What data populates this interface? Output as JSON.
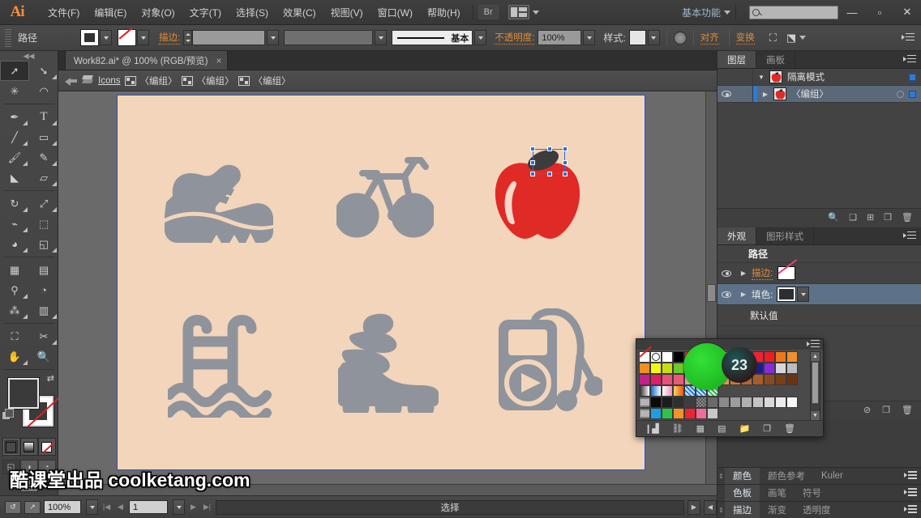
{
  "app": {
    "logo": "Ai"
  },
  "menubar": {
    "items": [
      "文件(F)",
      "编辑(E)",
      "对象(O)",
      "文字(T)",
      "选择(S)",
      "效果(C)",
      "视图(V)",
      "窗口(W)",
      "帮助(H)"
    ],
    "bridge": "Br",
    "workspace": "基本功能",
    "search_placeholder": ""
  },
  "controlbar": {
    "object_label": "路径",
    "stroke_label": "描边:",
    "stroke_weight": "",
    "stroke_profile": "",
    "brush_label": "基本",
    "opacity_label": "不透明度:",
    "opacity_value": "100%",
    "style_label": "样式:",
    "align_label": "对齐",
    "transform_label": "变换"
  },
  "toolbar": {
    "tools": [
      {
        "name": "selection-tool",
        "glyph": "➚",
        "selected": true
      },
      {
        "name": "direct-selection-tool",
        "glyph": "➘",
        "selected": false
      },
      {
        "name": "magic-wand-tool",
        "glyph": "✳",
        "selected": false
      },
      {
        "name": "lasso-tool",
        "glyph": "◠",
        "selected": false
      },
      {
        "name": "pen-tool",
        "glyph": "✒",
        "selected": false
      },
      {
        "name": "type-tool",
        "glyph": "T",
        "selected": false
      },
      {
        "name": "line-segment-tool",
        "glyph": "╱",
        "selected": false
      },
      {
        "name": "rectangle-tool",
        "glyph": "▭",
        "selected": false
      },
      {
        "name": "paintbrush-tool",
        "glyph": "🖌",
        "selected": false
      },
      {
        "name": "pencil-tool",
        "glyph": "✎",
        "selected": false
      },
      {
        "name": "blob-brush-tool",
        "glyph": "◣",
        "selected": false
      },
      {
        "name": "eraser-tool",
        "glyph": "▱",
        "selected": false
      },
      {
        "name": "rotate-tool",
        "glyph": "↻",
        "selected": false
      },
      {
        "name": "scale-tool",
        "glyph": "⤢",
        "selected": false
      },
      {
        "name": "width-tool",
        "glyph": "⌁",
        "selected": false
      },
      {
        "name": "free-transform-tool",
        "glyph": "⬚",
        "selected": false
      },
      {
        "name": "shape-builder-tool",
        "glyph": "◕",
        "selected": false
      },
      {
        "name": "perspective-grid-tool",
        "glyph": "◲",
        "selected": false
      },
      {
        "name": "mesh-tool",
        "glyph": "▦",
        "selected": false
      },
      {
        "name": "gradient-tool",
        "glyph": "▤",
        "selected": false
      },
      {
        "name": "eyedropper-tool",
        "glyph": "⚲",
        "selected": false
      },
      {
        "name": "blend-tool",
        "glyph": "◔",
        "selected": false
      },
      {
        "name": "symbol-sprayer-tool",
        "glyph": "⁂",
        "selected": false
      },
      {
        "name": "column-graph-tool",
        "glyph": "▥",
        "selected": false
      },
      {
        "name": "artboard-tool",
        "glyph": "⛶",
        "selected": false
      },
      {
        "name": "slice-tool",
        "glyph": "✂",
        "selected": false
      },
      {
        "name": "hand-tool",
        "glyph": "✋",
        "selected": false
      },
      {
        "name": "zoom-tool",
        "glyph": "🔍",
        "selected": false
      }
    ]
  },
  "document": {
    "tab_title": "Work82.ai* @ 100% (RGB/预览)",
    "close_glyph": "×"
  },
  "breadcrumb": {
    "root": "Icons",
    "groups": [
      "〈编组〉",
      "〈编组〉",
      "〈编组〉"
    ]
  },
  "canvas": {
    "artboard_bg": "#f2d5ba",
    "icon_color": "#8f939c",
    "apple_color": "#e02a26",
    "leaf_color": "#3c3c3c",
    "icons": [
      {
        "name": "sneaker-icon"
      },
      {
        "name": "bicycle-icon"
      },
      {
        "name": "apple-icon"
      },
      {
        "name": "pool-ladder-icon"
      },
      {
        "name": "roller-skate-icon"
      },
      {
        "name": "music-player-icon"
      }
    ]
  },
  "statusbar": {
    "zoom": "100%",
    "artboard_number": "1",
    "status_text": "选择"
  },
  "layers_panel": {
    "tabs": [
      "图层",
      "画板"
    ],
    "active_tab": "图层",
    "rows": [
      {
        "label": "隔离模式",
        "selected": false,
        "has_eye": false
      },
      {
        "label": "〈编组〉",
        "selected": true,
        "has_eye": true
      }
    ],
    "footer_icons": [
      "locate-object-icon",
      "make-clipping-mask-icon",
      "create-sublayer-icon",
      "create-new-layer-icon",
      "delete-layer-icon"
    ]
  },
  "appearance_panel": {
    "tabs": [
      "外观",
      "图形样式"
    ],
    "active_tab": "外观",
    "title": "路径",
    "rows": [
      {
        "label": "描边:",
        "type": "none"
      },
      {
        "label": "填色:",
        "type": "dark"
      }
    ],
    "opacity_label": "默认值",
    "footer_icons": [
      "add-new-stroke-icon",
      "add-new-fill-icon",
      "add-new-effect-icon",
      "clear-appearance-icon",
      "duplicate-item-icon",
      "delete-item-icon"
    ]
  },
  "bottom_tabs": {
    "row1": [
      "颜色",
      "颜色参考",
      "Kuler"
    ],
    "row1_active": "颜色",
    "row2": [
      "色板",
      "画笔",
      "符号"
    ],
    "row2_active": "色板",
    "row3": [
      "描边",
      "渐变",
      "透明度"
    ],
    "row3_active": "描边"
  },
  "swatches_panel": {
    "cursor_value": "23",
    "cursor_color": "#22c426",
    "rows": [
      [
        "none",
        "registration",
        "#ffffff",
        "#000000",
        "#ee1c25",
        "#2ee02e",
        "#45e045",
        "#6ef06e",
        "#1c2fd0",
        "#d01cd0",
        "#ee2233",
        "#ee1c25",
        "#f07818",
        "#f0902a"
      ],
      [
        "#f09020",
        "#f5f518",
        "#c8dc14",
        "#6ec828",
        "#38d83a",
        "#2fc42f",
        "#3adc3a",
        "#1a3a8a",
        "#1a84d8",
        "#2a2ad0",
        "#1c1c8c",
        "#8a2ad8",
        "#d8d8d8",
        "#bcbcbc"
      ],
      [
        "#c81e8c",
        "#e01e64",
        "#e8507a",
        "#e85a7a",
        "#d8a98a",
        "#d0a070",
        "#c89060",
        "#d89850",
        "#c07838",
        "#b06830",
        "#a85c28",
        "#8a4a20",
        "#7a3e18",
        "#6a3412"
      ],
      [
        "grad-gray",
        "grad-blue",
        "grad-pink",
        "grad-orange",
        "pattern-1",
        "pattern-2",
        "pattern-3"
      ],
      [
        "folder",
        "#0a0a0a",
        "#1c1c1c",
        "#2e2e2e",
        "#3e3e3e",
        "pattern-dot",
        "#6a6a6a",
        "#8a8a8a",
        "#9c9c9c",
        "#b0b0b0",
        "#c4c4c4",
        "#d8d8d8",
        "#ececec",
        "#f8f8f8"
      ],
      [
        "folder",
        "#1b9fe0",
        "#2ec44a",
        "#f0932a",
        "#ee2233",
        "#f06a9a",
        "#c8c8c8"
      ]
    ],
    "footer_icons": [
      "swatch-libraries-icon",
      "link-color-icon",
      "show-swatch-kinds-icon",
      "swatch-options-icon",
      "new-color-group-icon",
      "new-swatch-icon",
      "delete-swatch-icon"
    ]
  },
  "watermark": {
    "text": "酷课堂出品 coolketang.com"
  },
  "window_controls": {
    "minimize": "—",
    "maximize": "▫",
    "close": "✕"
  }
}
